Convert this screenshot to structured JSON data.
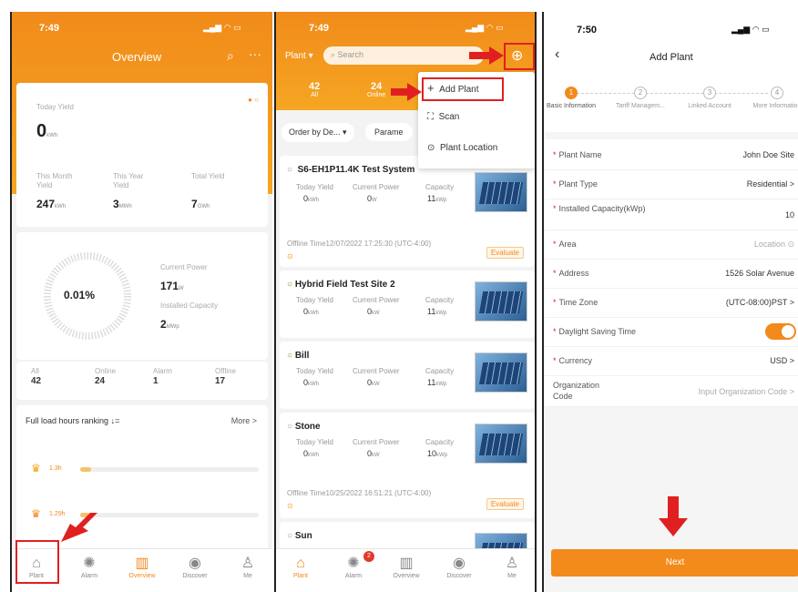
{
  "screen1": {
    "time": "7:49",
    "title": "Overview",
    "today_yield_label": "Today Yield",
    "today_yield_value": "0",
    "today_yield_unit": "kWh",
    "this_month_label": "This Month Yield",
    "this_month_value": "247",
    "this_month_unit": "kWh",
    "this_year_label": "This Year Yield",
    "this_year_value": "3",
    "this_year_unit": "MWh",
    "total_label": "Total Yield",
    "total_value": "7",
    "total_unit": "GWh",
    "gauge_percent": "0.01%",
    "current_power_label": "Current Power",
    "current_power_value": "171",
    "current_power_unit": "W",
    "installed_label": "Installed Capacity",
    "installed_value": "2",
    "installed_unit": "MWp",
    "counts": [
      {
        "label": "All",
        "value": "42"
      },
      {
        "label": "Online",
        "value": "24"
      },
      {
        "label": "Alarm",
        "value": "1"
      },
      {
        "label": "Offline",
        "value": "17"
      }
    ],
    "ranking_title": "Full load hours ranking",
    "ranking_sort": "↓=",
    "more": "More >",
    "rank_values": [
      "1.3h",
      "1.29h"
    ],
    "tabs": [
      "Plant",
      "Alarm",
      "Overview",
      "Discover",
      "Me"
    ]
  },
  "screen2": {
    "time": "7:49",
    "plant_dropdown": "Plant",
    "search_placeholder": "Search",
    "stats": [
      {
        "value": "42",
        "label": "All"
      },
      {
        "value": "24",
        "label": "Online"
      }
    ],
    "order_by": "Order by De...",
    "params": "Parame",
    "menu": {
      "add": "Add Plant",
      "scan": "Scan",
      "location": "Plant Location"
    },
    "col_labels": [
      "Today Yield",
      "Current Power",
      "Capacity"
    ],
    "plants": [
      {
        "name": "S6-EH1P11.4K Test System",
        "today": "0",
        "today_unit": "kWh",
        "power": "0",
        "power_unit": "W",
        "cap": "11",
        "cap_unit": "kWp",
        "offline": "Offline Time12/07/2022 17:25:30 (UTC-4:00)",
        "evaluate": "Evaluate",
        "status": "offline"
      },
      {
        "name": "Hybrid  Field Test Site 2",
        "today": "0",
        "today_unit": "kWh",
        "power": "0",
        "power_unit": "kW",
        "cap": "11",
        "cap_unit": "kWp",
        "status": "online"
      },
      {
        "name": "Bill",
        "today": "0",
        "today_unit": "kWh",
        "power": "0",
        "power_unit": "kW",
        "cap": "11",
        "cap_unit": "kWp",
        "status": "online"
      },
      {
        "name": "Stone",
        "today": "0",
        "today_unit": "kWh",
        "power": "0",
        "power_unit": "kW",
        "cap": "10",
        "cap_unit": "kWp",
        "offline": "Offline Time10/25/2022 16:51:21 (UTC-4:00)",
        "evaluate": "Evaluate",
        "status": "offline"
      },
      {
        "name": "Sun",
        "status": "offline"
      }
    ],
    "alarm_badge": "2",
    "tabs": [
      "Plant",
      "Alarm",
      "Overview",
      "Discover",
      "Me"
    ]
  },
  "screen3": {
    "time": "7:50",
    "title": "Add Plant",
    "steps": [
      {
        "num": "1",
        "label": "Basic Information"
      },
      {
        "num": "2",
        "label": "Tariff Managem..."
      },
      {
        "num": "3",
        "label": "Linked Account"
      },
      {
        "num": "4",
        "label": "More Information"
      }
    ],
    "fields": [
      {
        "label": "Plant Name",
        "value": "John Doe Site",
        "required": true
      },
      {
        "label": "Plant Type",
        "value": "Residential >",
        "required": true
      },
      {
        "label": "Installed Capacity(kWp)",
        "value": "10",
        "required": true
      },
      {
        "label": "Area",
        "value": "Location ⊙",
        "required": true
      },
      {
        "label": "Address",
        "value": "1526 Solar Avenue",
        "required": true
      },
      {
        "label": "Time Zone",
        "value": "(UTC-08:00)PST >",
        "required": true
      },
      {
        "label": "Daylight Saving Time",
        "value": "",
        "required": true
      },
      {
        "label": "Currency",
        "value": "USD >",
        "required": true
      },
      {
        "label": "Organization Code",
        "value": "Input Organization Code >",
        "required": false
      }
    ],
    "next": "Next",
    "daylight_saving_on": true
  },
  "colors": {
    "accent": "#f28a1c",
    "highlight": "#e02020",
    "online": "#5aa02c"
  }
}
